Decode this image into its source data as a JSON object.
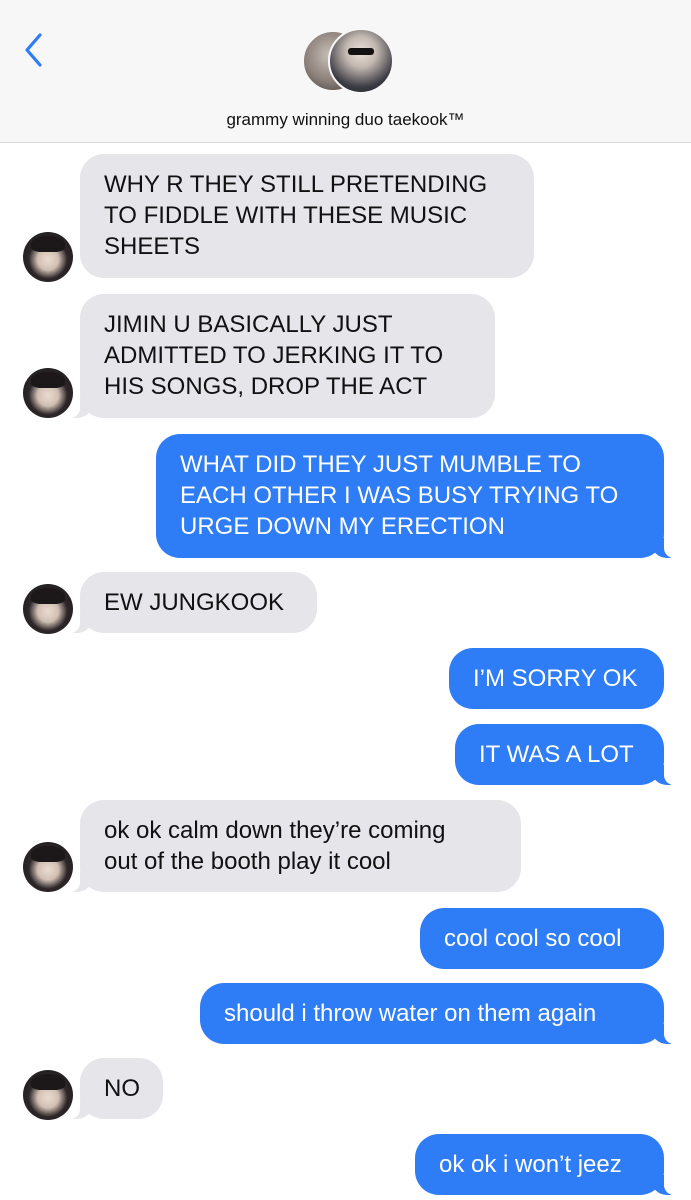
{
  "header": {
    "back_icon": "chevron-left-icon",
    "contact_name": "grammy winning duo taekook™",
    "accent_color": "#2e7cf6"
  },
  "messages": [
    {
      "side": "received",
      "lines": [
        "WHY R THEY STILL PRETENDING",
        "TO FIDDLE WITH THESE MUSIC",
        "SHEETS"
      ]
    },
    {
      "side": "received",
      "lines": [
        "JIMIN U BASICALLY JUST",
        "ADMITTED TO JERKING IT TO",
        "HIS SONGS, DROP THE ACT"
      ]
    },
    {
      "side": "sent",
      "lines": [
        "WHAT DID THEY JUST MUMBLE TO",
        "EACH OTHER I WAS BUSY TRYING TO",
        "URGE DOWN MY ERECTION"
      ]
    },
    {
      "side": "received",
      "lines": [
        "EW JUNGKOOK"
      ]
    },
    {
      "side": "sent",
      "lines": [
        "I’M SORRY OK"
      ]
    },
    {
      "side": "sent",
      "lines": [
        "IT WAS A LOT"
      ]
    },
    {
      "side": "received",
      "lines": [
        "ok ok calm down they’re coming",
        "out of the booth play it cool"
      ]
    },
    {
      "side": "sent",
      "lines": [
        "cool cool so cool"
      ]
    },
    {
      "side": "sent",
      "lines": [
        "should i throw water on them again"
      ]
    },
    {
      "side": "received",
      "lines": [
        "NO"
      ]
    },
    {
      "side": "sent",
      "lines": [
        "ok ok i won’t jeez"
      ]
    }
  ]
}
